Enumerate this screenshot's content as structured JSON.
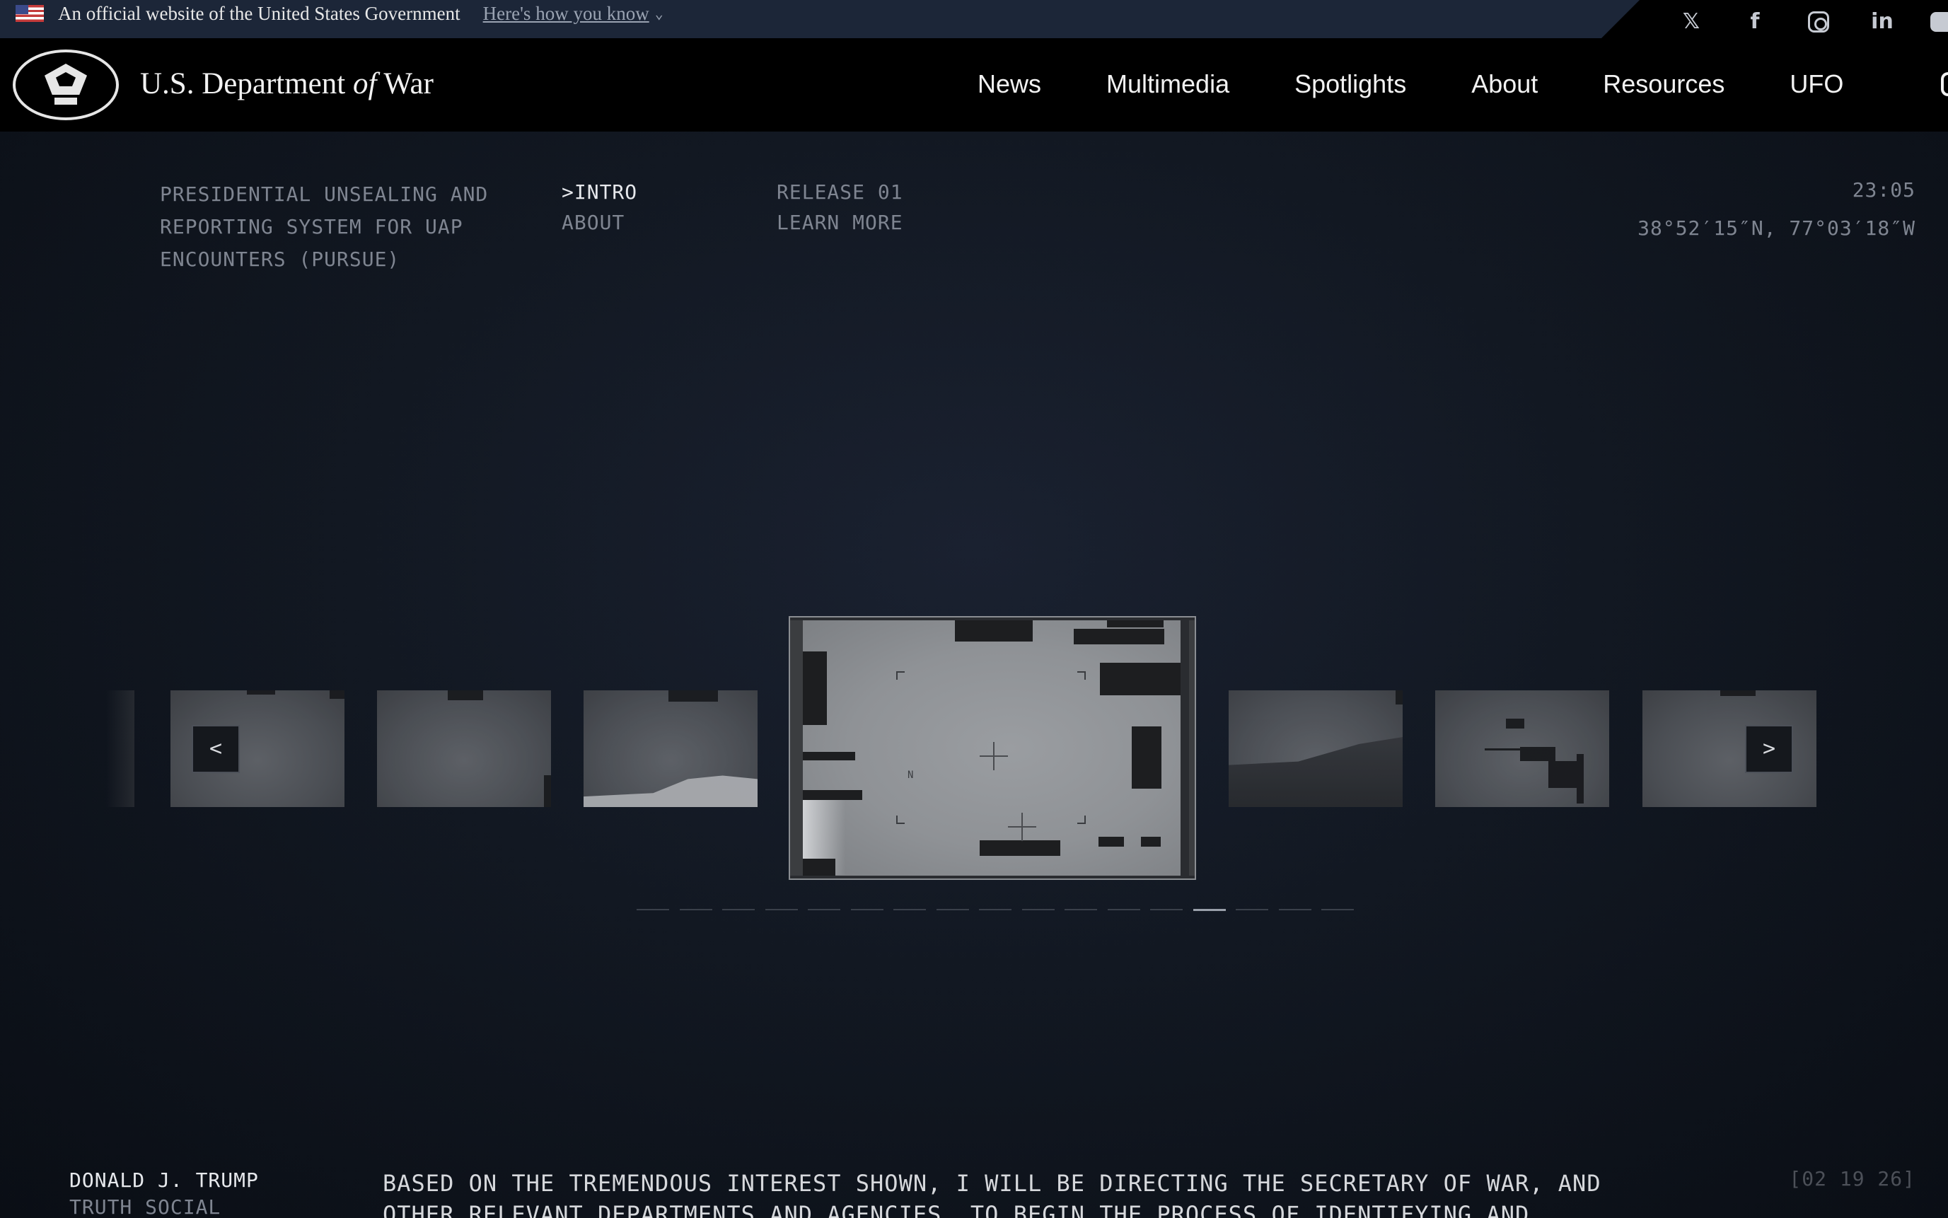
{
  "gov_banner": {
    "text": "An official website of the United States Government",
    "link": "Here's how you know",
    "chevron": "⌄"
  },
  "social": {
    "x": "𝕏",
    "facebook": "f",
    "instagram": "",
    "linkedin": "in",
    "youtube": ""
  },
  "header": {
    "title_pre": "U.S. Department ",
    "title_of": "of",
    "title_post": " War",
    "nav": [
      "News",
      "Multimedia",
      "Spotlights",
      "About",
      "Resources",
      "UFO"
    ]
  },
  "pursue": {
    "title": "PRESIDENTIAL UNSEALING AND REPORTING SYSTEM FOR UAP ENCOUNTERS (PURSUE)",
    "intro": ">INTRO",
    "about": "ABOUT",
    "release": "RELEASE 01",
    "learn_more": "LEARN MORE",
    "time": "23:05",
    "coords": "38°52′15″N, 77°03′18″W"
  },
  "carousel": {
    "prev_label": "<",
    "next_label": ">",
    "main_label": "N",
    "slide_count": 17,
    "active_slide": 13
  },
  "quote": {
    "author": "DONALD J. TRUMP",
    "source": "TRUTH SOCIAL",
    "text": "BASED ON THE TREMENDOUS INTEREST SHOWN, I WILL BE DIRECTING THE SECRETARY OF WAR, AND OTHER RELEVANT DEPARTMENTS AND AGENCIES, TO BEGIN THE PROCESS OF IDENTIFYING AND",
    "date": "[02 19 26]"
  },
  "colors": {
    "banner": "#1c2638",
    "header": "#000000",
    "background": "#121822",
    "accent": "#9aa0aa"
  }
}
